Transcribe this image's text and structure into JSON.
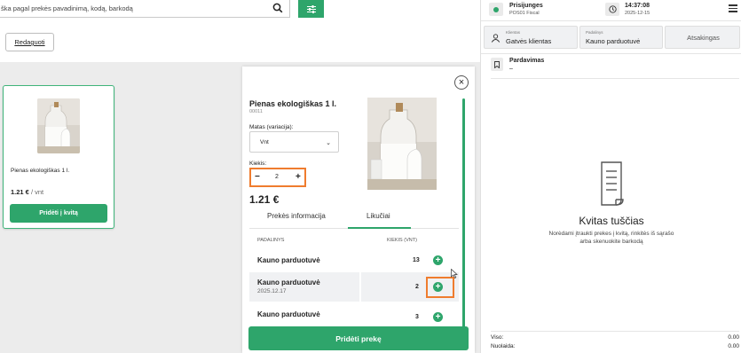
{
  "search": {
    "placeholder": "ška pagal prekės pavadinimą, kodą, barkodą"
  },
  "toolbar": {
    "edit_label": "Redaguoti"
  },
  "product_card": {
    "name": "Pienas ekologiškas 1 l.",
    "price": "1.21 €",
    "unit": " / vnt",
    "add_label": "Pridėti į kvitą"
  },
  "modal": {
    "title": "Pienas ekologiškas 1 l.",
    "code": "00011",
    "variation_label": "Matas (variacija):",
    "variation_value": "Vnt",
    "quantity_label": "Kiekis:",
    "quantity_value": "2",
    "minus": "−",
    "plus": "+",
    "price": "1.21 €",
    "tabs": [
      "Prekės informacija",
      "Likučiai"
    ],
    "table": {
      "headers": [
        "PADALINYS",
        "KIEKIS (VNT)"
      ],
      "rows": [
        {
          "store": "Kauno parduotuvė",
          "date": "",
          "qty": "13"
        },
        {
          "store": "Kauno parduotuvė",
          "date": "2025.12.17",
          "qty": "2"
        },
        {
          "store": "Kauno parduotuvė",
          "date": "",
          "qty": "3"
        }
      ]
    },
    "add_label": "Pridėti prekę"
  },
  "right": {
    "status_title": "Prisijunges",
    "status_sub": "POS01 Fiscal",
    "time": "14:37:08",
    "date": "2025-12-15",
    "client_small": "Klientas",
    "client_main": "Gatvės klientas",
    "division_small": "Padalinys",
    "division_main": "Kauno parduotuvė",
    "atsk_label": "Atsakingas",
    "sale_label": "Pardavimas",
    "sale_value": "–",
    "empty_title": "Kvitas tuščias",
    "empty_desc": "Norėdami įtraukti prekes į kvitą, rinkitės iš sąrašo arba skenuokite barkodą",
    "viso_label": "Viso:",
    "viso_value": "0.00",
    "nuolaida_label": "Nuolaida:",
    "nuolaida_value": "0.00"
  },
  "colors": {
    "accent": "#2ea56b",
    "highlight": "#ef7c2e"
  }
}
